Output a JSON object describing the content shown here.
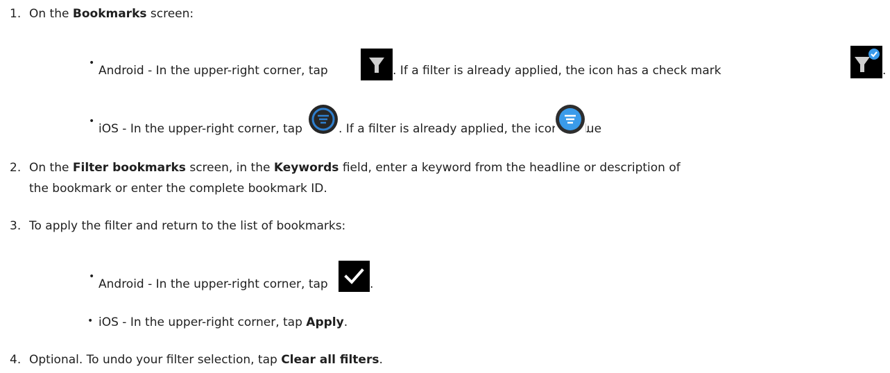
{
  "steps": [
    {
      "num": "1.",
      "pre": "On the ",
      "bold": "Bookmarks",
      "post": " screen:",
      "bullets": [
        {
          "text_a": "Android - In the upper-right corner, tap ",
          "icon_a": "filter-funnel-icon",
          "text_b": ". If a filter is already applied, the icon has a check mark",
          "icon_b": "filter-funnel-check-icon",
          "text_c": "."
        },
        {
          "text_a": "iOS - In the upper-right corner, tap ",
          "icon_a": "filter-circle-icon",
          "text_b": ". If a filter is already applied, the icon is blue ",
          "icon_b": "filter-circle-blue-icon",
          "text_c": "."
        }
      ]
    },
    {
      "num": "2.",
      "p1": "On the ",
      "b1": "Filter bookmarks",
      "p2": " screen, in the ",
      "b2": "Keywords",
      "p3": " field, enter a keyword from the headline or description of",
      "line2": "the bookmark or enter the complete bookmark ID."
    },
    {
      "num": "3.",
      "text": "To apply the filter and return to the list of bookmarks:",
      "bullets": [
        {
          "text_a": "Android - In the upper-right corner, tap ",
          "icon_a": "checkmark-icon",
          "text_c": "."
        },
        {
          "text_a": "iOS - In the upper-right corner, tap ",
          "bold": "Apply",
          "text_c": "."
        }
      ]
    },
    {
      "num": "4.",
      "pre": "Optional. To undo your filter selection, tap ",
      "bold": "Clear all filters",
      "post": "."
    }
  ],
  "colors": {
    "text": "#1f1f1f",
    "icon_bg": "#000000",
    "ios_blue": "#3a9bea",
    "ios_gray_bg": "#262626",
    "ios_ring_blue": "#2f7fce"
  }
}
